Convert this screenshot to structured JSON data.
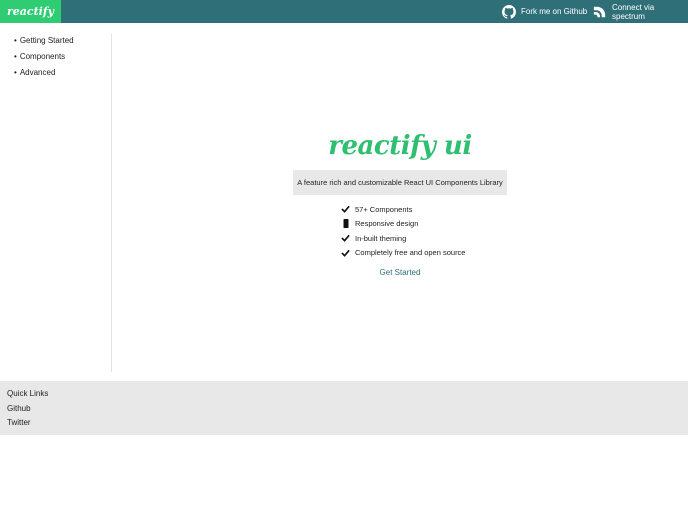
{
  "header": {
    "brand": "reactify ui",
    "github_link": "Fork me on Github",
    "spectrum_link": "Connect via spectrum"
  },
  "sidebar": {
    "items": [
      {
        "label": "Getting Started"
      },
      {
        "label": "Components"
      },
      {
        "label": "Advanced"
      }
    ]
  },
  "hero": {
    "logo": "reactify ui",
    "tagline": "A feature rich and customizable React UI Components Library",
    "features": [
      {
        "icon": "check-icon",
        "label": "57+ Components"
      },
      {
        "icon": "mobile-icon",
        "label": "Responsive design"
      },
      {
        "icon": "check-icon",
        "label": "In-built theming"
      },
      {
        "icon": "check-icon",
        "label": "Completely free and open source"
      }
    ],
    "cta": "Get Started"
  },
  "footer": {
    "links": [
      {
        "label": "Quick Links"
      },
      {
        "label": "Github"
      },
      {
        "label": "Twitter"
      }
    ]
  },
  "colors": {
    "topbar": "#2e6f78",
    "brand_bg": "#2fcc73",
    "logo_green": "#2fbf70",
    "link": "#2e6f78",
    "footer_bg": "#e8e8e8"
  }
}
